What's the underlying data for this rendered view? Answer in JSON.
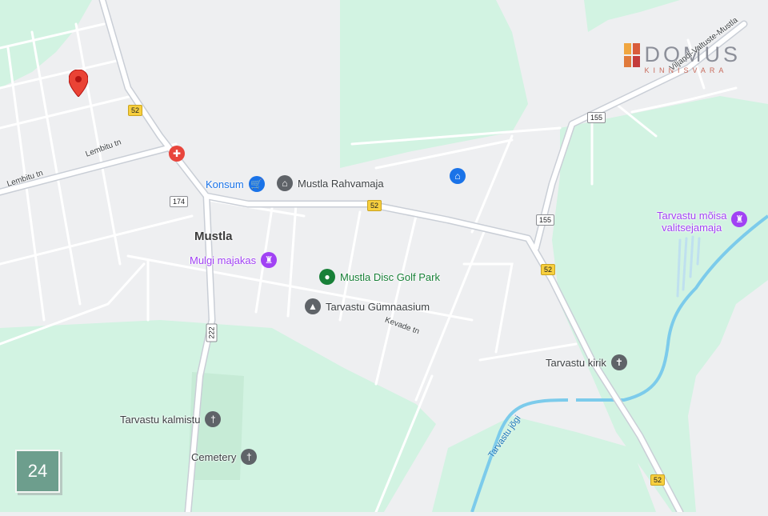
{
  "colors": {
    "land": "#eeeff1",
    "green": "#d2f3e2",
    "road": "#ffffff",
    "road_casing": "#c9ced6",
    "water": "#6fc3e8",
    "marker": "#ea4335"
  },
  "town": {
    "name": "Mustla"
  },
  "pois": [
    {
      "id": "konsum",
      "label": "Konsum",
      "icon": "shopping-cart-icon",
      "color": "#1a73e8"
    },
    {
      "id": "rahvamaja",
      "label": "Mustla Rahvamaja",
      "icon": "building-columns-icon",
      "color": "#5f6368"
    },
    {
      "id": "mulgi",
      "label": "Mulgi majakas",
      "icon": "tower-icon",
      "color": "#a142f4"
    },
    {
      "id": "discgolf",
      "label": "Mustla Disc Golf Park",
      "icon": "park-icon",
      "color": "#188038"
    },
    {
      "id": "gymnasium",
      "label": "Tarvastu Gümnaasium",
      "icon": "graduation-cap-icon",
      "color": "#5f6368"
    },
    {
      "id": "kirik",
      "label": "Tarvastu kirik",
      "icon": "cross-icon",
      "color": "#5f6368"
    },
    {
      "id": "kalmistu",
      "label": "Tarvastu kalmistu",
      "icon": "cemetery-icon",
      "color": "#5f6368"
    },
    {
      "id": "cemetery",
      "label": "Cemetery",
      "icon": "cemetery-icon",
      "color": "#5f6368"
    },
    {
      "id": "manor1",
      "label": "Tarvastu mõisa",
      "icon": "tower-icon",
      "color": "#a142f4"
    },
    {
      "id": "manor2",
      "label": "valitsejamaja",
      "icon": "",
      "color": "#a142f4"
    }
  ],
  "unlabeled_icons": [
    {
      "id": "hospital",
      "icon": "hospital-icon",
      "color": "#e8453c"
    },
    {
      "id": "house",
      "icon": "house-icon",
      "color": "#1a73e8"
    }
  ],
  "streets": [
    {
      "id": "lembitu1",
      "label": "Lembitu tn"
    },
    {
      "id": "lembitu2",
      "label": "Lembitu tn"
    },
    {
      "id": "kevade",
      "label": "Kevade tn"
    },
    {
      "id": "viljandi",
      "label": "Viljandi-Valtuste-Mustla"
    }
  ],
  "road_shields": [
    {
      "id": "s52a",
      "label": "52",
      "style": "yellow"
    },
    {
      "id": "s52b",
      "label": "52",
      "style": "yellow"
    },
    {
      "id": "s52c",
      "label": "52",
      "style": "yellow"
    },
    {
      "id": "s52d",
      "label": "52",
      "style": "yellow"
    },
    {
      "id": "s174",
      "label": "174",
      "style": "white"
    },
    {
      "id": "s155a",
      "label": "155",
      "style": "white"
    },
    {
      "id": "s155b",
      "label": "155",
      "style": "white"
    },
    {
      "id": "s222",
      "label": "222",
      "style": "white"
    }
  ],
  "water": [
    {
      "id": "river",
      "label": "Tarvastu jõgi"
    }
  ],
  "watermark": {
    "name": "DOMUS",
    "sub": "KINNISVARA"
  },
  "badge": {
    "text": "24"
  },
  "marker": {
    "icon": "location-pin-icon"
  }
}
